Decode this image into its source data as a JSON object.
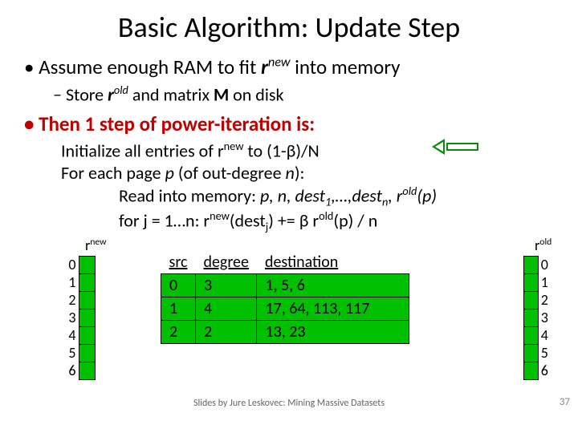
{
  "title": "Basic Algorithm: Update Step",
  "b1a_pre": "Assume enough RAM to fit ",
  "b1a_r": "r",
  "b1a_sup": "new",
  "b1a_post": " into memory",
  "b2_pre": "Store ",
  "b2_r": "r",
  "b2_sup": "old",
  "b2_mid": " and matrix ",
  "b2_M": "M",
  "b2_post": " on disk",
  "b1b": "Then 1 step of power-iteration is:",
  "algo": {
    "l1_pre": "Initialize all entries of r",
    "l1_sup": "new",
    "l1_post": " to (1-β)/N",
    "l2_pre": "For each page ",
    "l2_p": "p",
    "l2_mid": " (of out-degree ",
    "l2_n": "n",
    "l2_post": "):",
    "l3_pre": "Read into memory: ",
    "l3_rest": "p, n, dest",
    "l3_s1": "1",
    "l3_mid": ",…,dest",
    "l3_sn": "n",
    "l3_r": ", r",
    "l3_rsup": "old",
    "l3_post": "(p)",
    "l4_pre": "for j = 1…n: r",
    "l4_s1": "new",
    "l4_mid1": "(dest",
    "l4_sj": "j",
    "l4_mid2": ") += β r",
    "l4_s2": "old",
    "l4_post": "(p) / n"
  },
  "labels": {
    "rnew": "r",
    "rnew_sup": "new",
    "rold": "r",
    "rold_sup": "old"
  },
  "vec_left": [
    "0",
    "1",
    "2",
    "3",
    "4",
    "5",
    "6"
  ],
  "vec_right": [
    "0",
    "1",
    "2",
    "3",
    "4",
    "5",
    "6"
  ],
  "matrix": {
    "h1": "src",
    "h2": "degree",
    "h3": "destination",
    "rows": [
      {
        "src": "0",
        "deg": "3",
        "dest": "1, 5, 6"
      },
      {
        "src": "1",
        "deg": "4",
        "dest": "17, 64, 113, 117"
      },
      {
        "src": "2",
        "deg": "2",
        "dest": "13, 23"
      }
    ]
  },
  "footer": "Slides by Jure Leskovec: Mining Massive Datasets",
  "page": "37"
}
